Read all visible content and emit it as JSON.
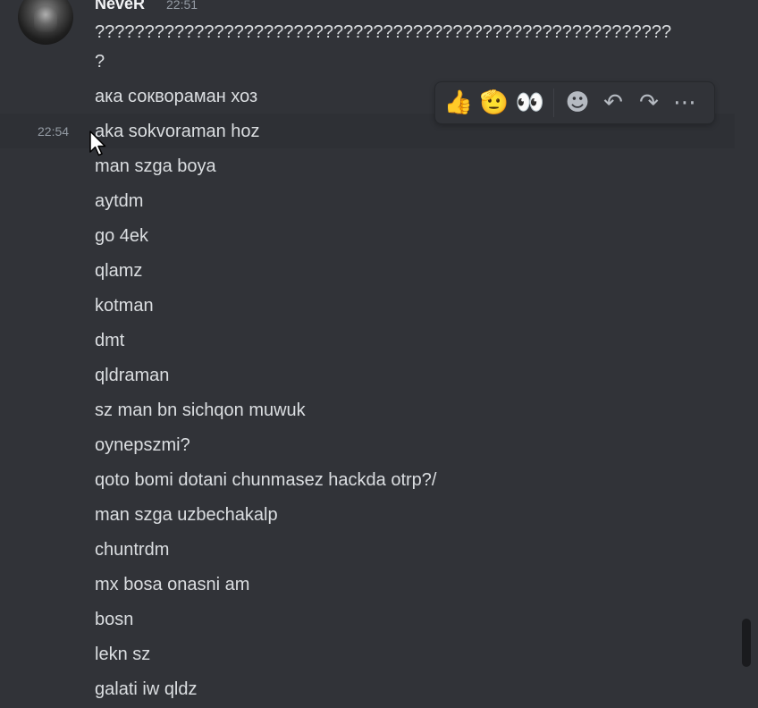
{
  "message_group": {
    "author": "NeveR",
    "timestamp": "22:51",
    "first_message": "?????????????????????????????????????????????????????????? ?",
    "messages": [
      {
        "text": "ака сокворамaн хоз"
      },
      {
        "text": "aka sokvoraman hoz",
        "hover_time": "22:54"
      },
      {
        "text": "man szga boya"
      },
      {
        "text": "aytdm"
      },
      {
        "text": "go 4ek"
      },
      {
        "text": "qlamz"
      },
      {
        "text": "kotman"
      },
      {
        "text": "dmt"
      },
      {
        "text": "qldraman"
      },
      {
        "text": "sz man bn sichqon muwuk"
      },
      {
        "text": "oynepszmi?"
      },
      {
        "text": "qoto bomi dotani chunmasez hackda otrp?/"
      },
      {
        "text": "man szga uzbechakalp"
      },
      {
        "text": "chuntrdm"
      },
      {
        "text": "mx bosa onasni am"
      },
      {
        "text": "bosn"
      },
      {
        "text": "lekn sz"
      },
      {
        "text": "galati iw qldz"
      }
    ]
  },
  "toolbar": {
    "reactions": [
      {
        "emoji": "👍",
        "icon": "thumbs-up-icon"
      },
      {
        "emoji": "🫡",
        "icon": "saluting-face-icon"
      },
      {
        "emoji": "👀",
        "icon": "eyes-icon"
      }
    ],
    "actions": [
      {
        "icon": "add-reaction-icon",
        "glyph": "☻"
      },
      {
        "icon": "reply-icon",
        "glyph": "↶"
      },
      {
        "icon": "forward-icon",
        "glyph": "↷"
      },
      {
        "icon": "more-icon",
        "glyph": "⋯"
      }
    ]
  },
  "colors": {
    "background": "#313338",
    "hover_row": "#2e3035",
    "text": "#dbdee1",
    "muted": "#949ba4",
    "author": "#f2f3f5"
  }
}
